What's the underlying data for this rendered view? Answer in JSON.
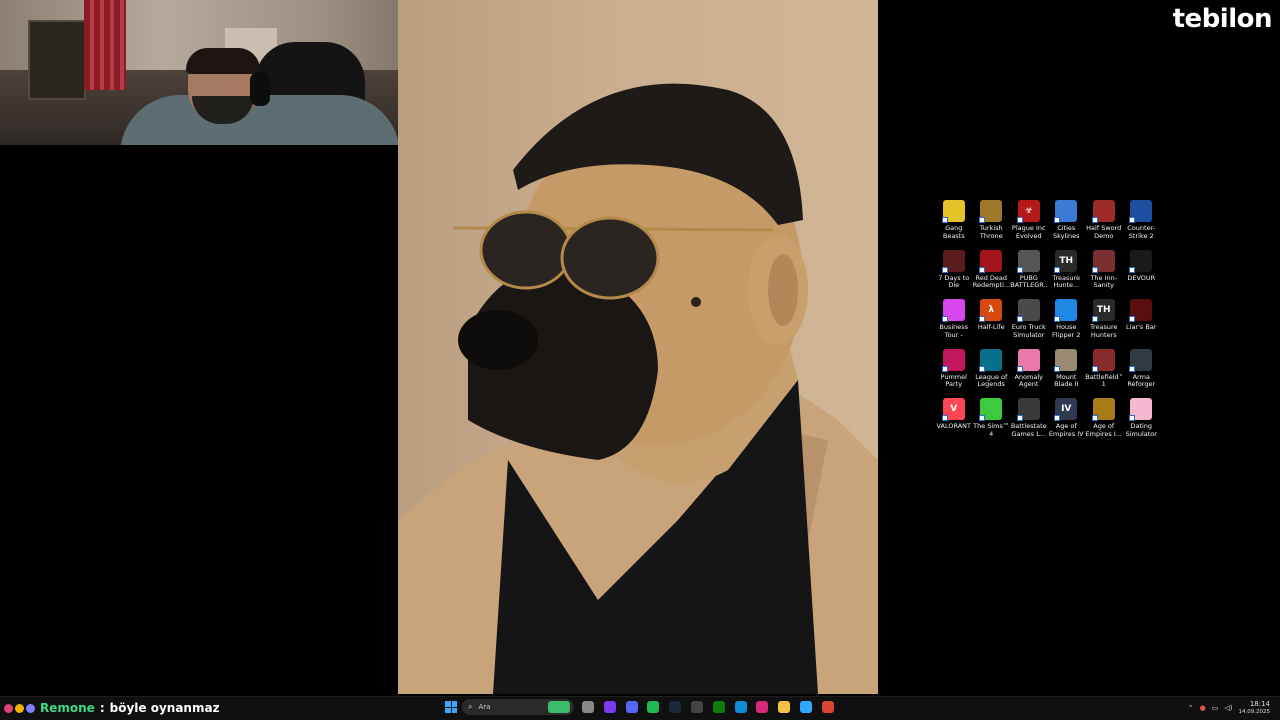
{
  "branding": {
    "logo_text": "tebilon"
  },
  "chat": {
    "username": "Remone",
    "separator": ":",
    "message": "böyle oynanmaz",
    "badge_colors": [
      "#e0417a",
      "#f0b400",
      "#7f7fff"
    ]
  },
  "taskbar": {
    "search_placeholder": "Ara",
    "time": "18:14",
    "date": "14.09.2025",
    "apps": [
      {
        "name": "browser-icon",
        "color": "#3dbb6a"
      },
      {
        "name": "files-icon",
        "color": "#888888"
      },
      {
        "name": "obs-icon",
        "color": "#7c3aed"
      },
      {
        "name": "discord-icon",
        "color": "#5865f2"
      },
      {
        "name": "spotify-icon",
        "color": "#1db954"
      },
      {
        "name": "steam-icon",
        "color": "#1b2838"
      },
      {
        "name": "epic-icon",
        "color": "#444444"
      },
      {
        "name": "xbox-icon",
        "color": "#107c10"
      },
      {
        "name": "edge-icon",
        "color": "#0f8bd8"
      },
      {
        "name": "instagram-icon",
        "color": "#d62976"
      },
      {
        "name": "folder-icon",
        "color": "#f5c242"
      },
      {
        "name": "photoshop-icon",
        "color": "#31a8ff"
      },
      {
        "name": "chrome-icon",
        "color": "#db4437"
      }
    ]
  },
  "desktop_icons": [
    {
      "label": "Gang Beasts",
      "color": "#e6c229",
      "glyph": ""
    },
    {
      "label": "Turkish Throne",
      "color": "#a0782c",
      "glyph": ""
    },
    {
      "label": "Plague Inc Evolved",
      "color": "#b51a1a",
      "glyph": "☣"
    },
    {
      "label": "Cities Skylines",
      "color": "#3a7bd5",
      "glyph": ""
    },
    {
      "label": "Half Sword Demo",
      "color": "#9b2b2b",
      "glyph": ""
    },
    {
      "label": "Counter-Strike 2",
      "color": "#1f4fa0",
      "glyph": ""
    },
    {
      "label": "7 Days to Die",
      "color": "#5a1c1c",
      "glyph": ""
    },
    {
      "label": "Red Dead Redempti...",
      "color": "#a3141a",
      "glyph": ""
    },
    {
      "label": "PUBG BATTLEGR...",
      "color": "#555555",
      "glyph": ""
    },
    {
      "label": "Treasure Hunte...",
      "color": "#2a2a2a",
      "glyph": "TH"
    },
    {
      "label": "The Inn-Sanity",
      "color": "#7a2e2e",
      "glyph": ""
    },
    {
      "label": "DEVOUR",
      "color": "#1a1a1a",
      "glyph": ""
    },
    {
      "label": "Business Tour - Onli...",
      "color": "#d946ef",
      "glyph": ""
    },
    {
      "label": "Half-Life",
      "color": "#d9480f",
      "glyph": "λ"
    },
    {
      "label": "Euro Truck Simulator 2",
      "color": "#4a4a4a",
      "glyph": ""
    },
    {
      "label": "House Flipper 2",
      "color": "#1e88e5",
      "glyph": ""
    },
    {
      "label": "Treasure Hunters",
      "color": "#2a2a2a",
      "glyph": "TH"
    },
    {
      "label": "Liar's Bar",
      "color": "#5a0f0f",
      "glyph": ""
    },
    {
      "label": "Pummel Party",
      "color": "#c2185b",
      "glyph": ""
    },
    {
      "label": "League of Legends",
      "color": "#0a6f8a",
      "glyph": ""
    },
    {
      "label": "Anomaly Agent",
      "color": "#e879a9",
      "glyph": ""
    },
    {
      "label": "Mount  Blade II Bannerlord",
      "color": "#9a8a72",
      "glyph": ""
    },
    {
      "label": "Battlefield™ 1",
      "color": "#8a2b2b",
      "glyph": ""
    },
    {
      "label": "Arma Reforger",
      "color": "#2f3b3f",
      "glyph": ""
    },
    {
      "label": "VALORANT",
      "color": "#ff4655",
      "glyph": "V"
    },
    {
      "label": "The Sims™ 4",
      "color": "#3ec93e",
      "glyph": ""
    },
    {
      "label": "Battlestate Games L...",
      "color": "#3a3a3a",
      "glyph": ""
    },
    {
      "label": "Age of Empires IV",
      "color": "#2f3a52",
      "glyph": "IV"
    },
    {
      "label": "Age of Empires I...",
      "color": "#a87a1a",
      "glyph": ""
    },
    {
      "label": "Dating Simulator",
      "color": "#f5b8d0",
      "glyph": ""
    }
  ]
}
